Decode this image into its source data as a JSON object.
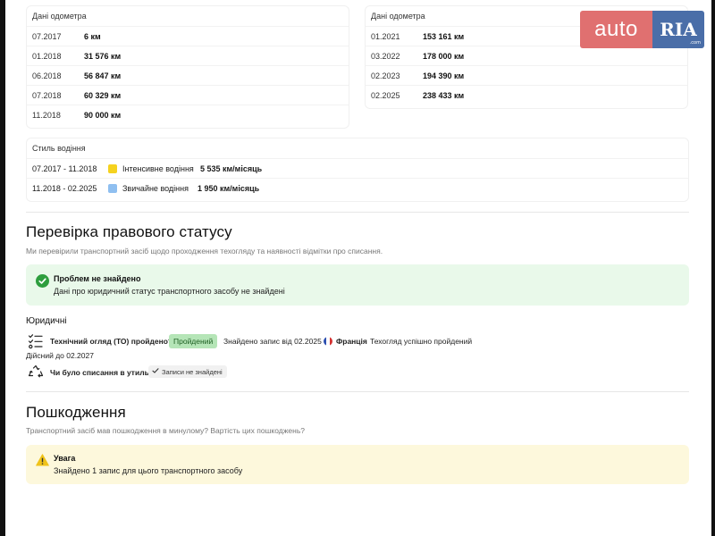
{
  "brand": {
    "auto": "auto",
    "ria": "RIA",
    "domain": ".com",
    "colors": {
      "auto_bg": "#e07070",
      "ria_bg": "#4a6ea8"
    }
  },
  "odometer_left": {
    "title": "Дані одометра",
    "rows": [
      {
        "date": "07.2017",
        "value": "6 км"
      },
      {
        "date": "01.2018",
        "value": "31 576 км"
      },
      {
        "date": "06.2018",
        "value": "56 847 км"
      },
      {
        "date": "07.2018",
        "value": "60 329 км"
      },
      {
        "date": "11.2018",
        "value": "90 000 км"
      }
    ]
  },
  "odometer_right": {
    "title": "Дані одометра",
    "rows": [
      {
        "date": "01.2021",
        "value": "153 161 км"
      },
      {
        "date": "03.2022",
        "value": "178 000 км"
      },
      {
        "date": "02.2023",
        "value": "194 390 км"
      },
      {
        "date": "02.2025",
        "value": "238 433 км"
      }
    ]
  },
  "driving_style": {
    "title": "Стиль водіння",
    "rows": [
      {
        "period": "07.2017 - 11.2018",
        "label": "Інтенсивне водіння",
        "value": "5 535 км/місяць",
        "color": "#f5d21f"
      },
      {
        "period": "11.2018 - 02.2025",
        "label": "Звичайне водіння",
        "value": "1 950 км/місяць",
        "color": "#8fbff0"
      }
    ]
  },
  "legal": {
    "heading": "Перевірка правового статусу",
    "description": "Ми перевірили транспортний засіб щодо проходження техогляду та наявності відмітки про списання.",
    "banner_title": "Проблем не знайдено",
    "banner_text": "Дані про юридичний статус транспортного засобу не знайдені",
    "section_title": "Юридичні",
    "inspection_question": "Технічний огляд (ТО) пройдено?",
    "inspection_badge": "Пройдений",
    "inspection_record": "Знайдено запис від 02.2025",
    "inspection_country": "Франція",
    "inspection_result": "Техогляд успішно пройдений",
    "valid_until": "Дійсний до 02.2027",
    "scrap_question": "Чи було списання в утиль?",
    "scrap_badge": "Записи не знайдені",
    "colors": {
      "banner_bg": "#e9f9ea",
      "ok": "#2e9e3e"
    }
  },
  "damage": {
    "heading": "Пошкодження",
    "description": "Транспортний засіб мав пошкодження в минулому? Вартість цих пошкоджень?",
    "banner_title": "Увага",
    "banner_text": "Знайдено 1 запис для цього транспортного засобу",
    "colors": {
      "banner_bg": "#fdf8dc",
      "warn": "#f0c31a"
    }
  }
}
